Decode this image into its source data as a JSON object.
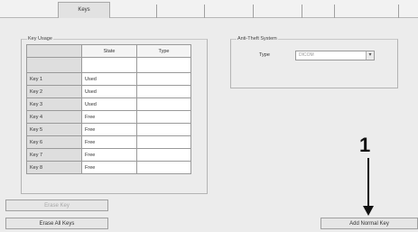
{
  "tabs": [
    {
      "label": "Keys",
      "active": true
    },
    {
      "label": "",
      "active": false
    },
    {
      "label": "",
      "active": false
    },
    {
      "label": "",
      "active": false
    },
    {
      "label": "",
      "active": false
    },
    {
      "label": "",
      "active": false
    }
  ],
  "key_usage": {
    "title": "Key Usage",
    "columns": [
      "",
      "State",
      "Type"
    ],
    "rows": [
      {
        "key": "",
        "state": "",
        "type": ""
      },
      {
        "key": "Key 1",
        "state": "Used",
        "type": ""
      },
      {
        "key": "Key 2",
        "state": "Used",
        "type": ""
      },
      {
        "key": "Key 3",
        "state": "Used",
        "type": ""
      },
      {
        "key": "Key 4",
        "state": "Free",
        "type": ""
      },
      {
        "key": "Key 5",
        "state": "Free",
        "type": ""
      },
      {
        "key": "Key 6",
        "state": "Free",
        "type": ""
      },
      {
        "key": "Key 7",
        "state": "Free",
        "type": ""
      },
      {
        "key": "Key 8",
        "state": "Free",
        "type": ""
      }
    ]
  },
  "anti_theft": {
    "title": "Anti-Theft System",
    "type_label": "Type",
    "type_value": "DICOM"
  },
  "buttons": {
    "erase_key": "Erase Key",
    "erase_all": "Erase All Keys",
    "add_normal": "Add Normal Key"
  },
  "annotation": {
    "number": "1"
  },
  "colors": {
    "window_bg": "#ececec",
    "annotation": "#111111"
  }
}
